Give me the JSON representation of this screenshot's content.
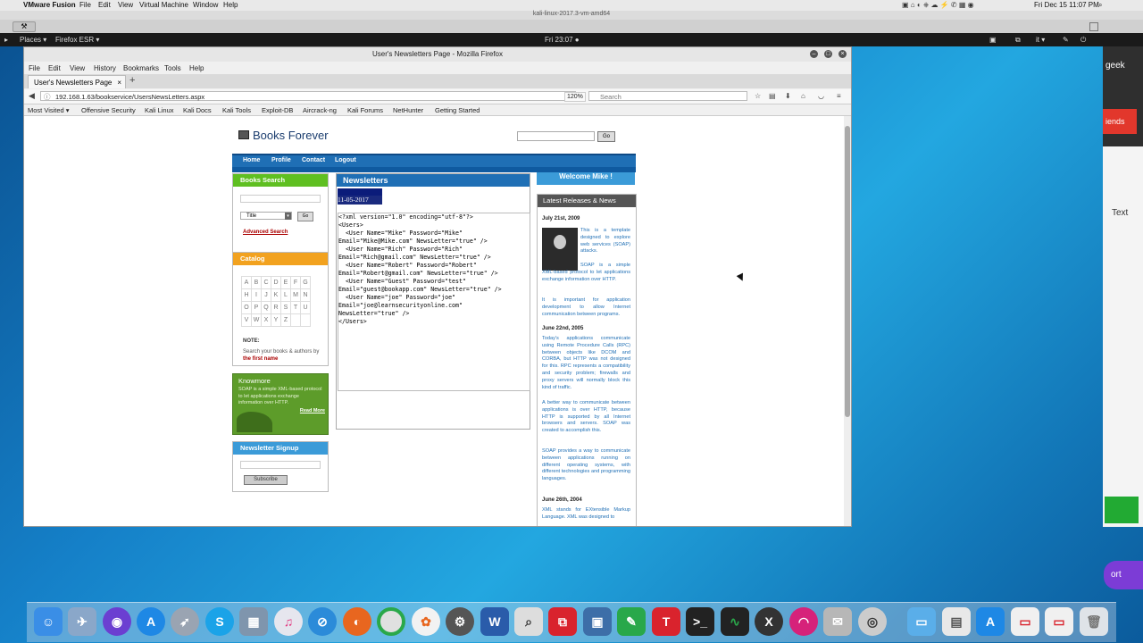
{
  "mac_menubar": {
    "app": "VMware Fusion",
    "items": [
      "File",
      "Edit",
      "View",
      "Virtual Machine",
      "Window",
      "Help"
    ],
    "clock": "Fri Dec 15  11:07 PM"
  },
  "vm": {
    "title": "kali-linux-2017.3-vm-amd64"
  },
  "kali_panel": {
    "places": "Places ▾",
    "app": "Firefox ESR ▾",
    "clock": "Fri 23:07 ●",
    "lang": "it ▾"
  },
  "side_window": {
    "text1": "geek",
    "red": "iends",
    "text_label": "Text",
    "purple": "ort"
  },
  "firefox": {
    "title": "User's Newsletters Page - Mozilla Firefox",
    "menu": [
      "File",
      "Edit",
      "View",
      "History",
      "Bookmarks",
      "Tools",
      "Help"
    ],
    "tab_title": "User's Newsletters Page",
    "url": "192.168.1.63/bookservice/UsersNewsLetters.aspx",
    "zoom": "120%",
    "search_placeholder": "Search",
    "bookmarks": [
      "Most Visited ▾",
      "Offensive Security",
      "Kali Linux",
      "Kali Docs",
      "Kali Tools",
      "Exploit-DB",
      "Aircrack-ng",
      "Kali Forums",
      "NetHunter",
      "Getting Started"
    ]
  },
  "site": {
    "title": "Books Forever",
    "search_button": "Go",
    "nav": [
      "Home",
      "Profile",
      "Contact",
      "Logout"
    ],
    "books_search": {
      "title": "Books Search",
      "select_value": "Title",
      "go": "Go",
      "advanced": "Advanced Search"
    },
    "catalog": {
      "title": "Catalog",
      "letters": [
        [
          "A",
          "B",
          "C",
          "D",
          "E",
          "F",
          "G"
        ],
        [
          "H",
          "I",
          "J",
          "K",
          "L",
          "M",
          "N"
        ],
        [
          "O",
          "P",
          "Q",
          "R",
          "S",
          "T",
          "U"
        ],
        [
          "V",
          "W",
          "X",
          "Y",
          "Z",
          "",
          ""
        ]
      ],
      "note_label": "NOTE:",
      "note_text": "Search your books & authors by",
      "note_emphasis": "the first name"
    },
    "knowmore": {
      "title": "Knowmore",
      "body": "SOAP is a simple XML-based protocol to let applications exchange information over HTTP.",
      "more": "Read More"
    },
    "newsletter_signup": {
      "title": "Newsletter Signup",
      "button": "Subscribe"
    },
    "newsletters": {
      "title": "Newsletters",
      "date": "11-05-2017",
      "xml": "<?xml version=\"1.0\" encoding=\"utf-8\"?>\n<Users>\n  <User Name=\"Mike\" Password=\"Mike\"\nEmail=\"Mike@Mike.com\" NewsLetter=\"true\" />\n  <User Name=\"Rich\" Password=\"Rich\"\nEmail=\"Rich@gmail.com\" NewsLetter=\"true\" />\n  <User Name=\"Robert\" Password=\"Robert\"\nEmail=\"Robert@gmail.com\" NewsLetter=\"true\" />\n  <User Name=\"Guest\" Password=\"test\"\nEmail=\"guest@bookapp.com\" NewsLetter=\"true\" />\n  <User Name=\"joe\" Password=\"joe\"\nEmail=\"joe@learnsecurityonline.com\"\nNewsLetter=\"true\" />\n</Users>"
    },
    "welcome": "Welcome Mike !",
    "releases": {
      "title": "Latest Releases & News",
      "date1": "July 21st, 2009",
      "text1a": "This is a template designed to explore web services (SOAP) attacks.",
      "text1b": "SOAP is a simple XML-based protocol to let applications exchange information over HTTP.",
      "text1c": "It is important for application development to allow Internet communication between programs.",
      "date2": "June 22nd, 2005",
      "text2a": "Today's applications communicate using Remote Procedure Calls (RPC) between objects like DCOM and CORBA, but HTTP was not designed for this. RPC represents a compatibility and security problem; firewalls and proxy servers will normally block this kind of traffic.",
      "text2b": "A better way to communicate between applications is over HTTP, because HTTP is supported by all Internet browsers and servers. SOAP was created to accomplish this.",
      "text2c": "SOAP provides a way to communicate between applications running on different operating systems, with different technologies and programming languages.",
      "date3": "June 26th, 2004",
      "text3a": "XML stands for EXtensible Markup Language. XML was designed to"
    }
  },
  "dock": {
    "apps": [
      "Finder",
      "Preview",
      "Siri",
      "App Store",
      "Launchpad",
      "Skype",
      "Photos",
      "iTunes",
      "Safari",
      "Firefox",
      "Chrome",
      "Photos Library",
      "Disk Utility",
      "Word",
      "Magnifier",
      "Parallels",
      "VirtualBox",
      "Evernote",
      "TextSoap",
      "Terminal",
      "Activity Monitor",
      "XQuartz",
      "Lips",
      "Archive",
      "Switch",
      "Folder",
      "Documents",
      "App Store 2",
      "Screenshot",
      "Downloads",
      "Trash"
    ],
    "colors": {
      "blue": "#2a7de1",
      "orange": "#e8661f",
      "green": "#29a84a",
      "red": "#d9232d",
      "dark": "#333333",
      "purple": "#7c3cd6"
    }
  }
}
